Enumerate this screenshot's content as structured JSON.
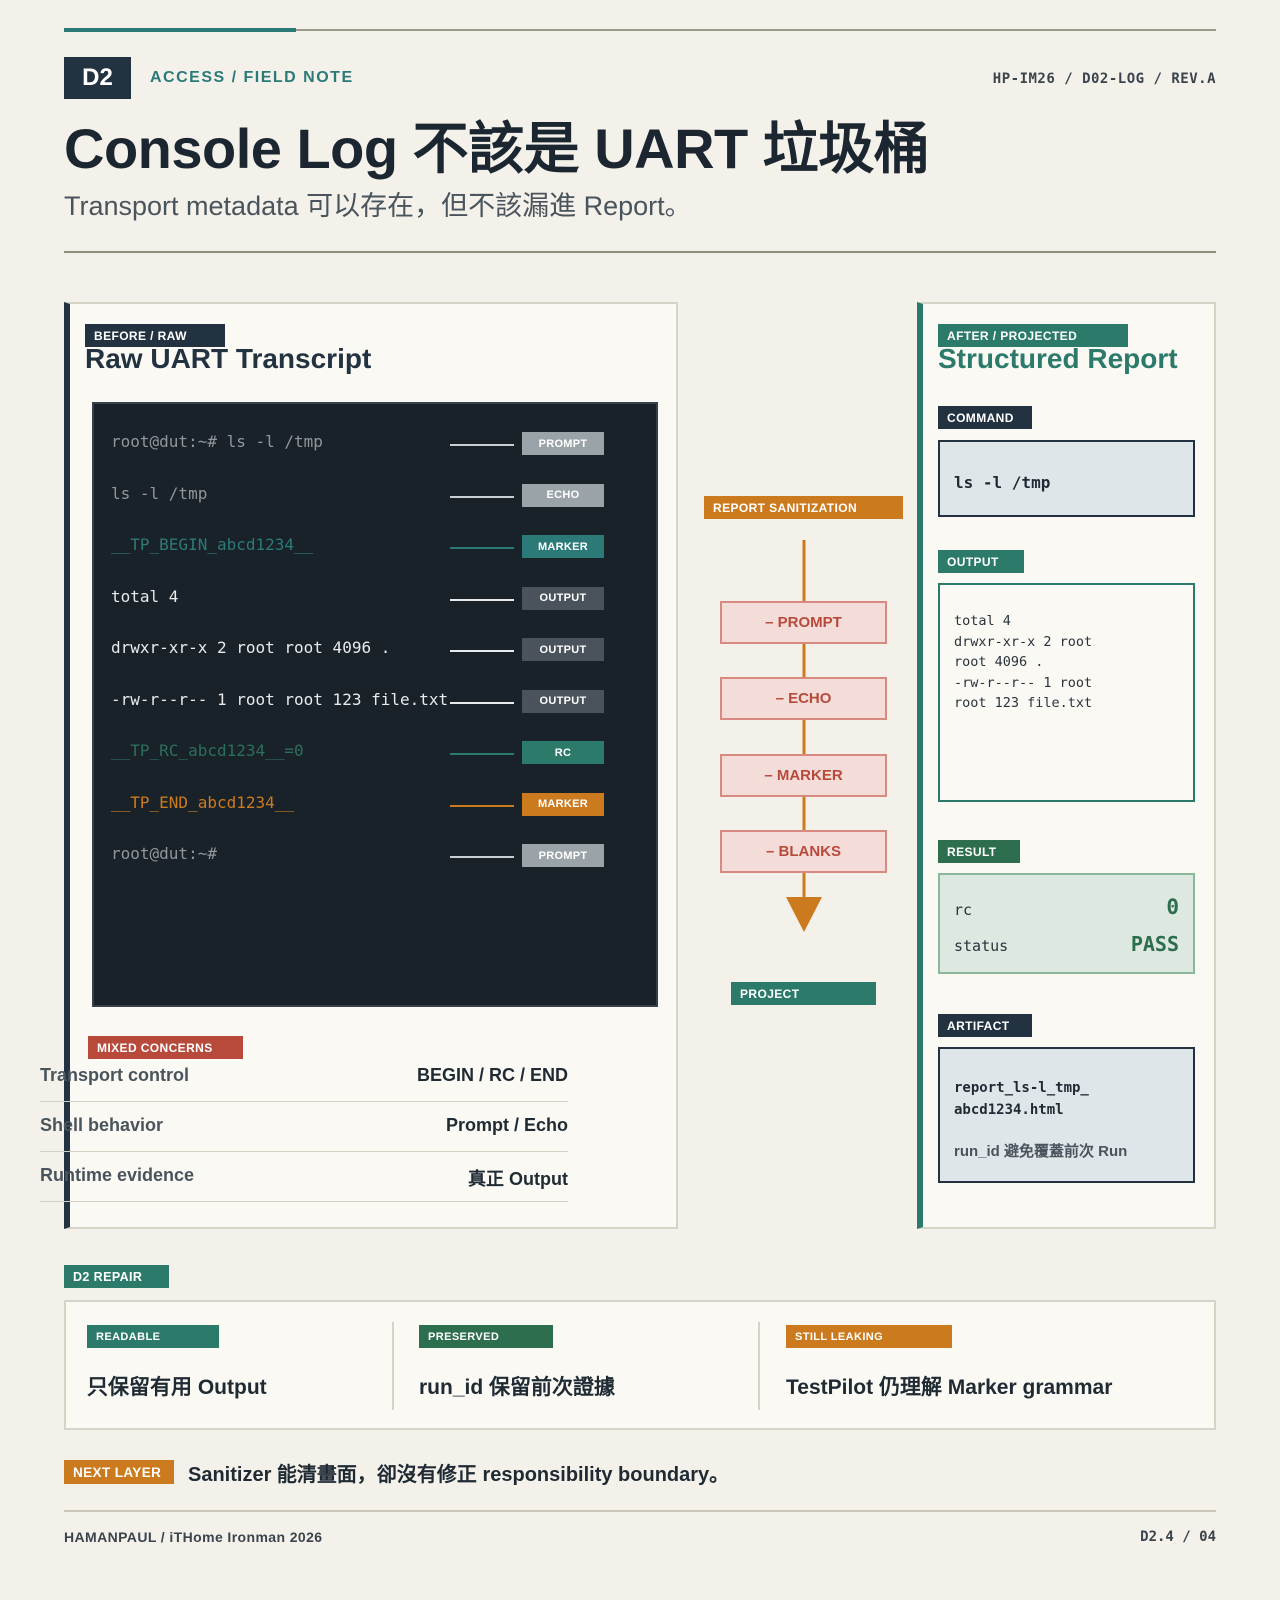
{
  "header": {
    "badge": "D2",
    "section": "ACCESS / FIELD NOTE",
    "doc_id": "HP-IM26 / D02-LOG / REV.A",
    "title": "Console Log 不該是 UART 垃圾桶",
    "subtitle": "Transport metadata 可以存在，但不該漏進 Report。"
  },
  "before": {
    "tag": "BEFORE / RAW",
    "title": "Raw UART Transcript",
    "lines": [
      {
        "text": "root@dut:~# ls -l /tmp",
        "chip": "PROMPT",
        "kind": "prompt"
      },
      {
        "text": "ls -l /tmp",
        "chip": "ECHO",
        "kind": "echo"
      },
      {
        "text": "__TP_BEGIN_abcd1234__",
        "chip": "MARKER",
        "kind": "marker-teal"
      },
      {
        "text": "total 4",
        "chip": "OUTPUT",
        "kind": "output"
      },
      {
        "text": "drwxr-xr-x 2 root root 4096 .",
        "chip": "OUTPUT",
        "kind": "output"
      },
      {
        "text": "-rw-r--r-- 1 root root 123 file.txt",
        "chip": "OUTPUT",
        "kind": "output"
      },
      {
        "text": "__TP_RC_abcd1234__=0",
        "chip": "RC",
        "kind": "rc"
      },
      {
        "text": "__TP_END_abcd1234__",
        "chip": "MARKER",
        "kind": "marker-orange"
      },
      {
        "text": "root@dut:~#",
        "chip": "PROMPT",
        "kind": "prompt"
      }
    ],
    "mixed_tag": "MIXED CONCERNS",
    "mixed": [
      {
        "key": "Transport control",
        "value": "BEGIN / RC / END"
      },
      {
        "key": "Shell behavior",
        "value": "Prompt / Echo"
      },
      {
        "key": "Runtime evidence",
        "value": "真正 Output"
      }
    ]
  },
  "flow": {
    "tag": "REPORT SANITIZATION",
    "steps": [
      "– PROMPT",
      "– ECHO",
      "– MARKER",
      "– BLANKS"
    ],
    "project": "PROJECT"
  },
  "after": {
    "tag": "AFTER / PROJECTED",
    "title": "Structured Report",
    "command_tag": "COMMAND",
    "command": "ls -l /tmp",
    "output_tag": "OUTPUT",
    "output_lines": [
      "total 4",
      "drwxr-xr-x 2 root",
      "root 4096 .",
      "-rw-r--r-- 1 root",
      "root 123 file.txt"
    ],
    "result_tag": "RESULT",
    "rc_label": "rc",
    "rc_value": "0",
    "status_label": "status",
    "status_value": "PASS",
    "artifact_tag": "ARTIFACT",
    "artifact_line1": "report_ls-l_tmp_",
    "artifact_line2": "abcd1234.html",
    "artifact_note": "run_id 避免覆蓋前次 Run"
  },
  "repair": {
    "tag": "D2 REPAIR",
    "cols": [
      {
        "tag": "READABLE",
        "text": "只保留有用 Output"
      },
      {
        "tag": "PRESERVED",
        "text": "run_id 保留前次證據"
      },
      {
        "tag": "STILL LEAKING",
        "text": "TestPilot 仍理解 Marker grammar"
      }
    ]
  },
  "next": {
    "tag": "NEXT LAYER",
    "text": "Sanitizer 能清畫面，卻沒有修正 responsibility boundary。"
  },
  "footer": {
    "left": "HAMANPAUL / iTHome Ironman 2026",
    "right": "D2.4 / 04"
  },
  "colors": {
    "navy": "#233241",
    "teal": "#2b7a78",
    "orange": "#cc7a1e",
    "red": "#b84a3c",
    "green": "#2d6e4e"
  }
}
